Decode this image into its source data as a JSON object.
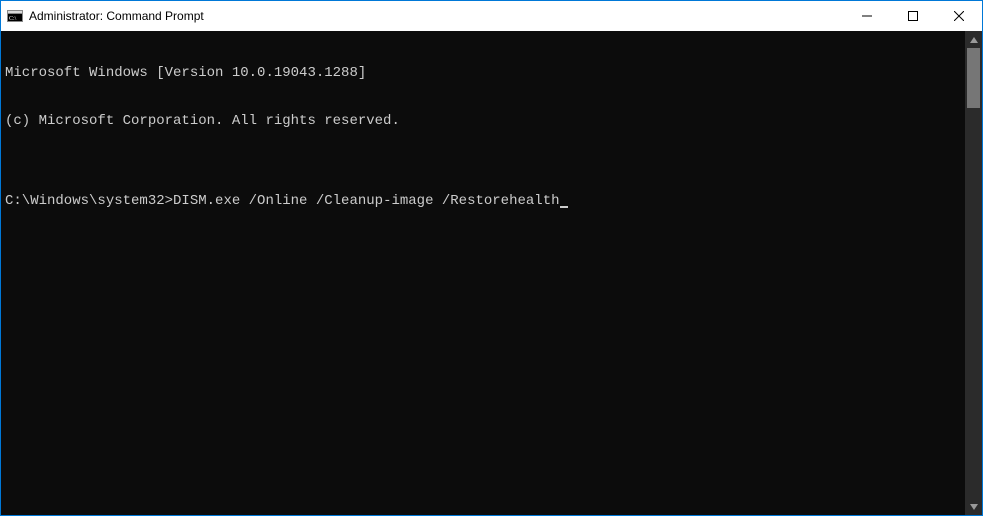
{
  "window": {
    "title": "Administrator: Command Prompt"
  },
  "terminal": {
    "line1": "Microsoft Windows [Version 10.0.19043.1288]",
    "line2": "(c) Microsoft Corporation. All rights reserved.",
    "blank": "",
    "prompt": "C:\\Windows\\system32>",
    "command": "DISM.exe /Online /Cleanup-image /Restorehealth"
  }
}
